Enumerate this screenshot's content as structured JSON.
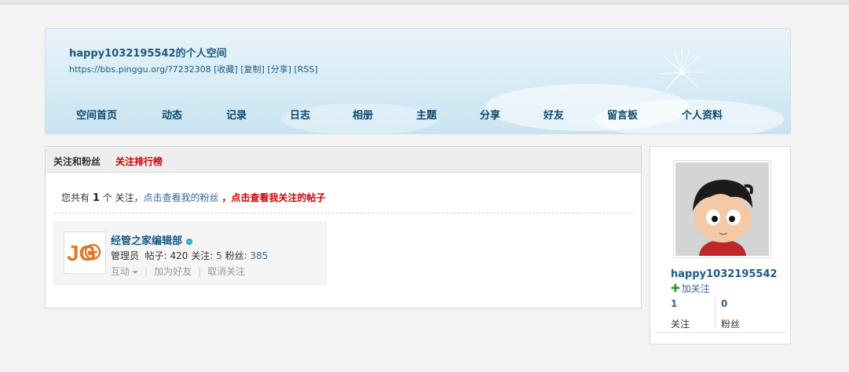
{
  "header": {
    "title": "happy1032195542的个人空间",
    "url": "https://bbs.pinggu.org/?7232308",
    "links": [
      "[收藏]",
      "[复制]",
      "[分享]",
      "[RSS]"
    ],
    "nav": [
      "空间首页",
      "动态",
      "记录",
      "日志",
      "相册",
      "主题",
      "分享",
      "好友",
      "留言板",
      "个人资料"
    ]
  },
  "main": {
    "tab_follow": "关注和粉丝",
    "tab_rank": "关注排行榜",
    "summary": {
      "prefix": "您共有",
      "count": "1",
      "suffix": "个 关注，",
      "link_fans": "点击查看我的粉丝",
      "comma": "，",
      "link_posts": "点击查看我关注的帖子"
    },
    "card": {
      "avatar_text": "JG",
      "name": "经管之家编辑部",
      "role": "管理员",
      "posts_label": "帖子:",
      "posts": "420",
      "follow_label": "关注:",
      "follow": "5",
      "fans_label": "粉丝:",
      "fans": "385",
      "action_interact": "互动",
      "action_add_friend": "加为好友",
      "action_unfollow": "取消关注"
    }
  },
  "side": {
    "username": "happy1032195542",
    "add_follow": "加关注",
    "following_count": "1",
    "following_label": "关注",
    "fans_count": "0",
    "fans_label": "粉丝"
  }
}
